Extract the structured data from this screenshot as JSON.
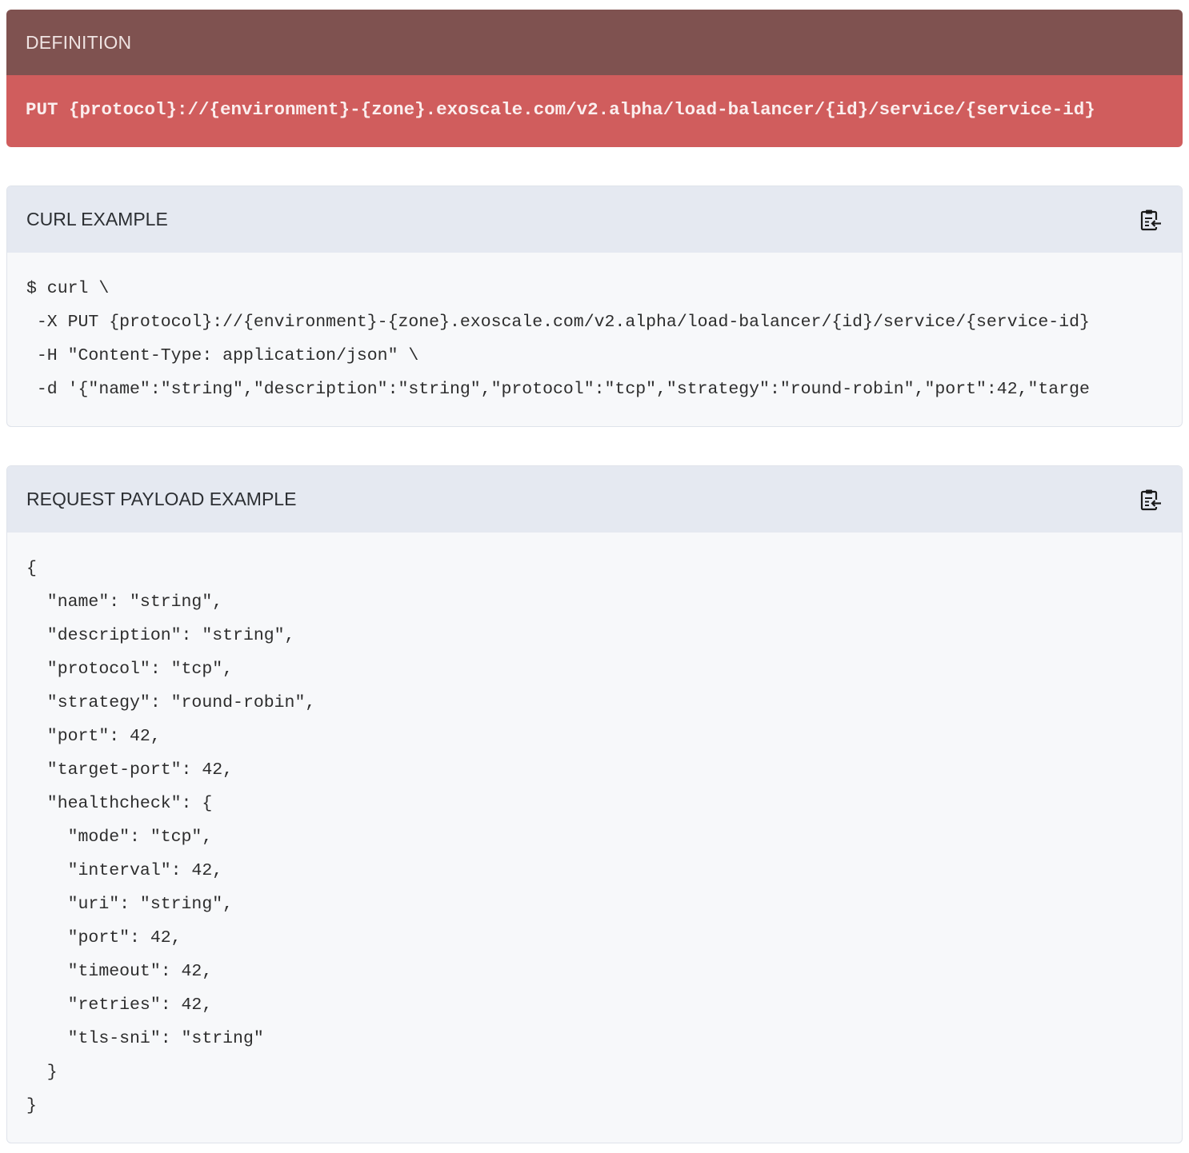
{
  "definition": {
    "title": "DEFINITION",
    "endpoint": "PUT {protocol}://{environment}-{zone}.exoscale.com/v2.alpha/load-balancer/{id}/service/{service-id}"
  },
  "curl": {
    "title": "CURL EXAMPLE",
    "copy_icon": "clipboard-copy-icon",
    "lines": [
      "$ curl \\",
      " -X PUT {protocol}://{environment}-{zone}.exoscale.com/v2.alpha/load-balancer/{id}/service/{service-id}",
      " -H \"Content-Type: application/json\" \\",
      " -d '{\"name\":\"string\",\"description\":\"string\",\"protocol\":\"tcp\",\"strategy\":\"round-robin\",\"port\":42,\"targe"
    ]
  },
  "payload": {
    "title": "REQUEST PAYLOAD EXAMPLE",
    "copy_icon": "clipboard-copy-icon",
    "lines": [
      "{",
      "  \"name\": \"string\",",
      "  \"description\": \"string\",",
      "  \"protocol\": \"tcp\",",
      "  \"strategy\": \"round-robin\",",
      "  \"port\": 42,",
      "  \"target-port\": 42,",
      "  \"healthcheck\": {",
      "    \"mode\": \"tcp\",",
      "    \"interval\": 42,",
      "    \"uri\": \"string\",",
      "    \"port\": 42,",
      "    \"timeout\": 42,",
      "    \"retries\": 42,",
      "    \"tls-sni\": \"string\"",
      "  }",
      "}"
    ]
  }
}
